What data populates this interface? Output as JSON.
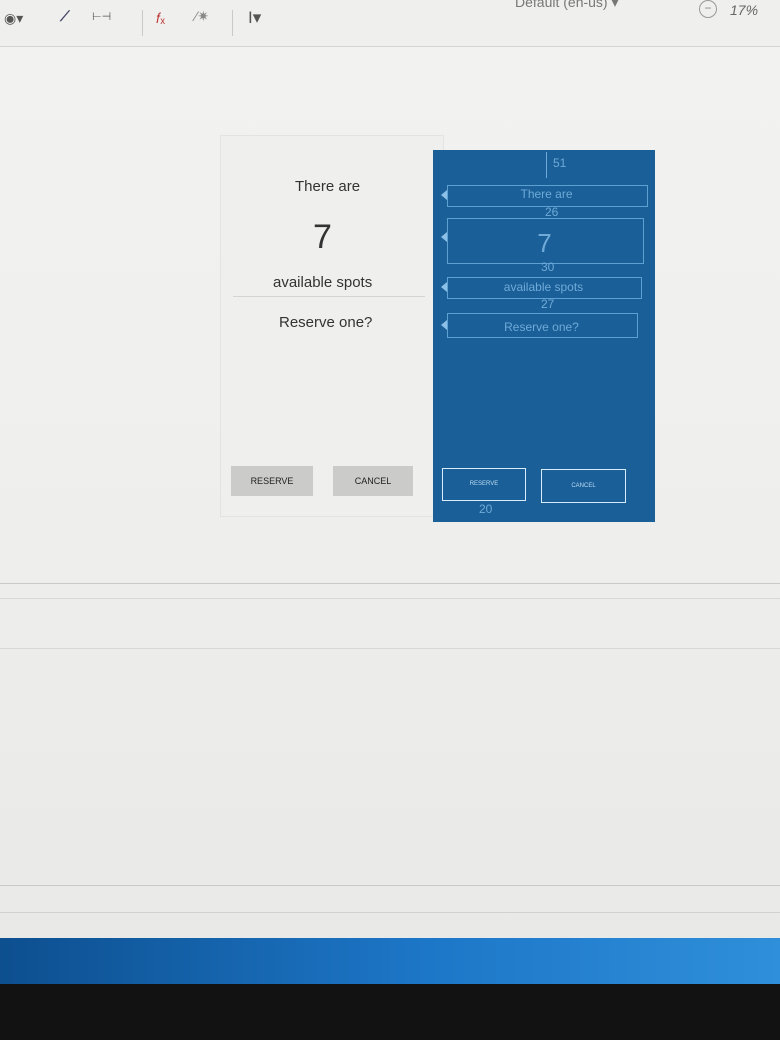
{
  "toolbar": {
    "device_label": "Default (en-us)",
    "zoom": "17%"
  },
  "design": {
    "line1": "There are",
    "count": "7",
    "line2": "available spots",
    "question": "Reserve one?",
    "reserve_label": "RESERVE",
    "cancel_label": "CANCEL"
  },
  "blueprint": {
    "top_margin": "51",
    "line1": "There are",
    "gap1": "26",
    "count": "7",
    "gap2": "30",
    "line2": "available spots",
    "gap3": "27",
    "question": "Reserve one?",
    "reserve_label": "RESERVE",
    "cancel_label": "CANCEL",
    "bottom_margin": "20"
  },
  "colors": {
    "blueprint_bg": "#1a5f97",
    "blueprint_outline": "#5ea0d2",
    "button_gray": "#cbcbc9",
    "taskbar": "#1d77c8"
  }
}
